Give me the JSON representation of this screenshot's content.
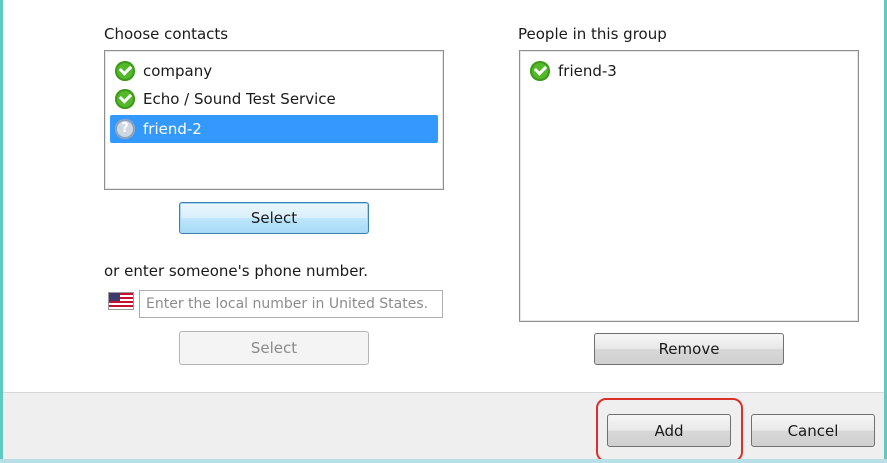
{
  "choose_contacts": {
    "label": "Choose contacts",
    "items": [
      {
        "name": "company",
        "icon": "skype-online-icon",
        "selected": false
      },
      {
        "name": "Echo / Sound Test Service",
        "icon": "skype-online-icon",
        "selected": false
      },
      {
        "name": "friend-2",
        "icon": "skype-unknown-status-icon",
        "selected": true
      }
    ],
    "select_button": "Select"
  },
  "phone": {
    "label": "or enter someone's phone number.",
    "flag_icon": "us-flag-icon",
    "placeholder": "Enter the local number in United States.",
    "select_button": "Select"
  },
  "group": {
    "label": "People in this group",
    "items": [
      {
        "name": "friend-3",
        "icon": "skype-online-icon"
      }
    ],
    "remove_button": "Remove"
  },
  "footer": {
    "add_button": "Add",
    "cancel_button": "Cancel"
  },
  "colors": {
    "selection": "#3399ff",
    "online_green": "#53b82a",
    "highlight_ring": "#d9312a",
    "frame_accent": "#5fc9c2"
  }
}
